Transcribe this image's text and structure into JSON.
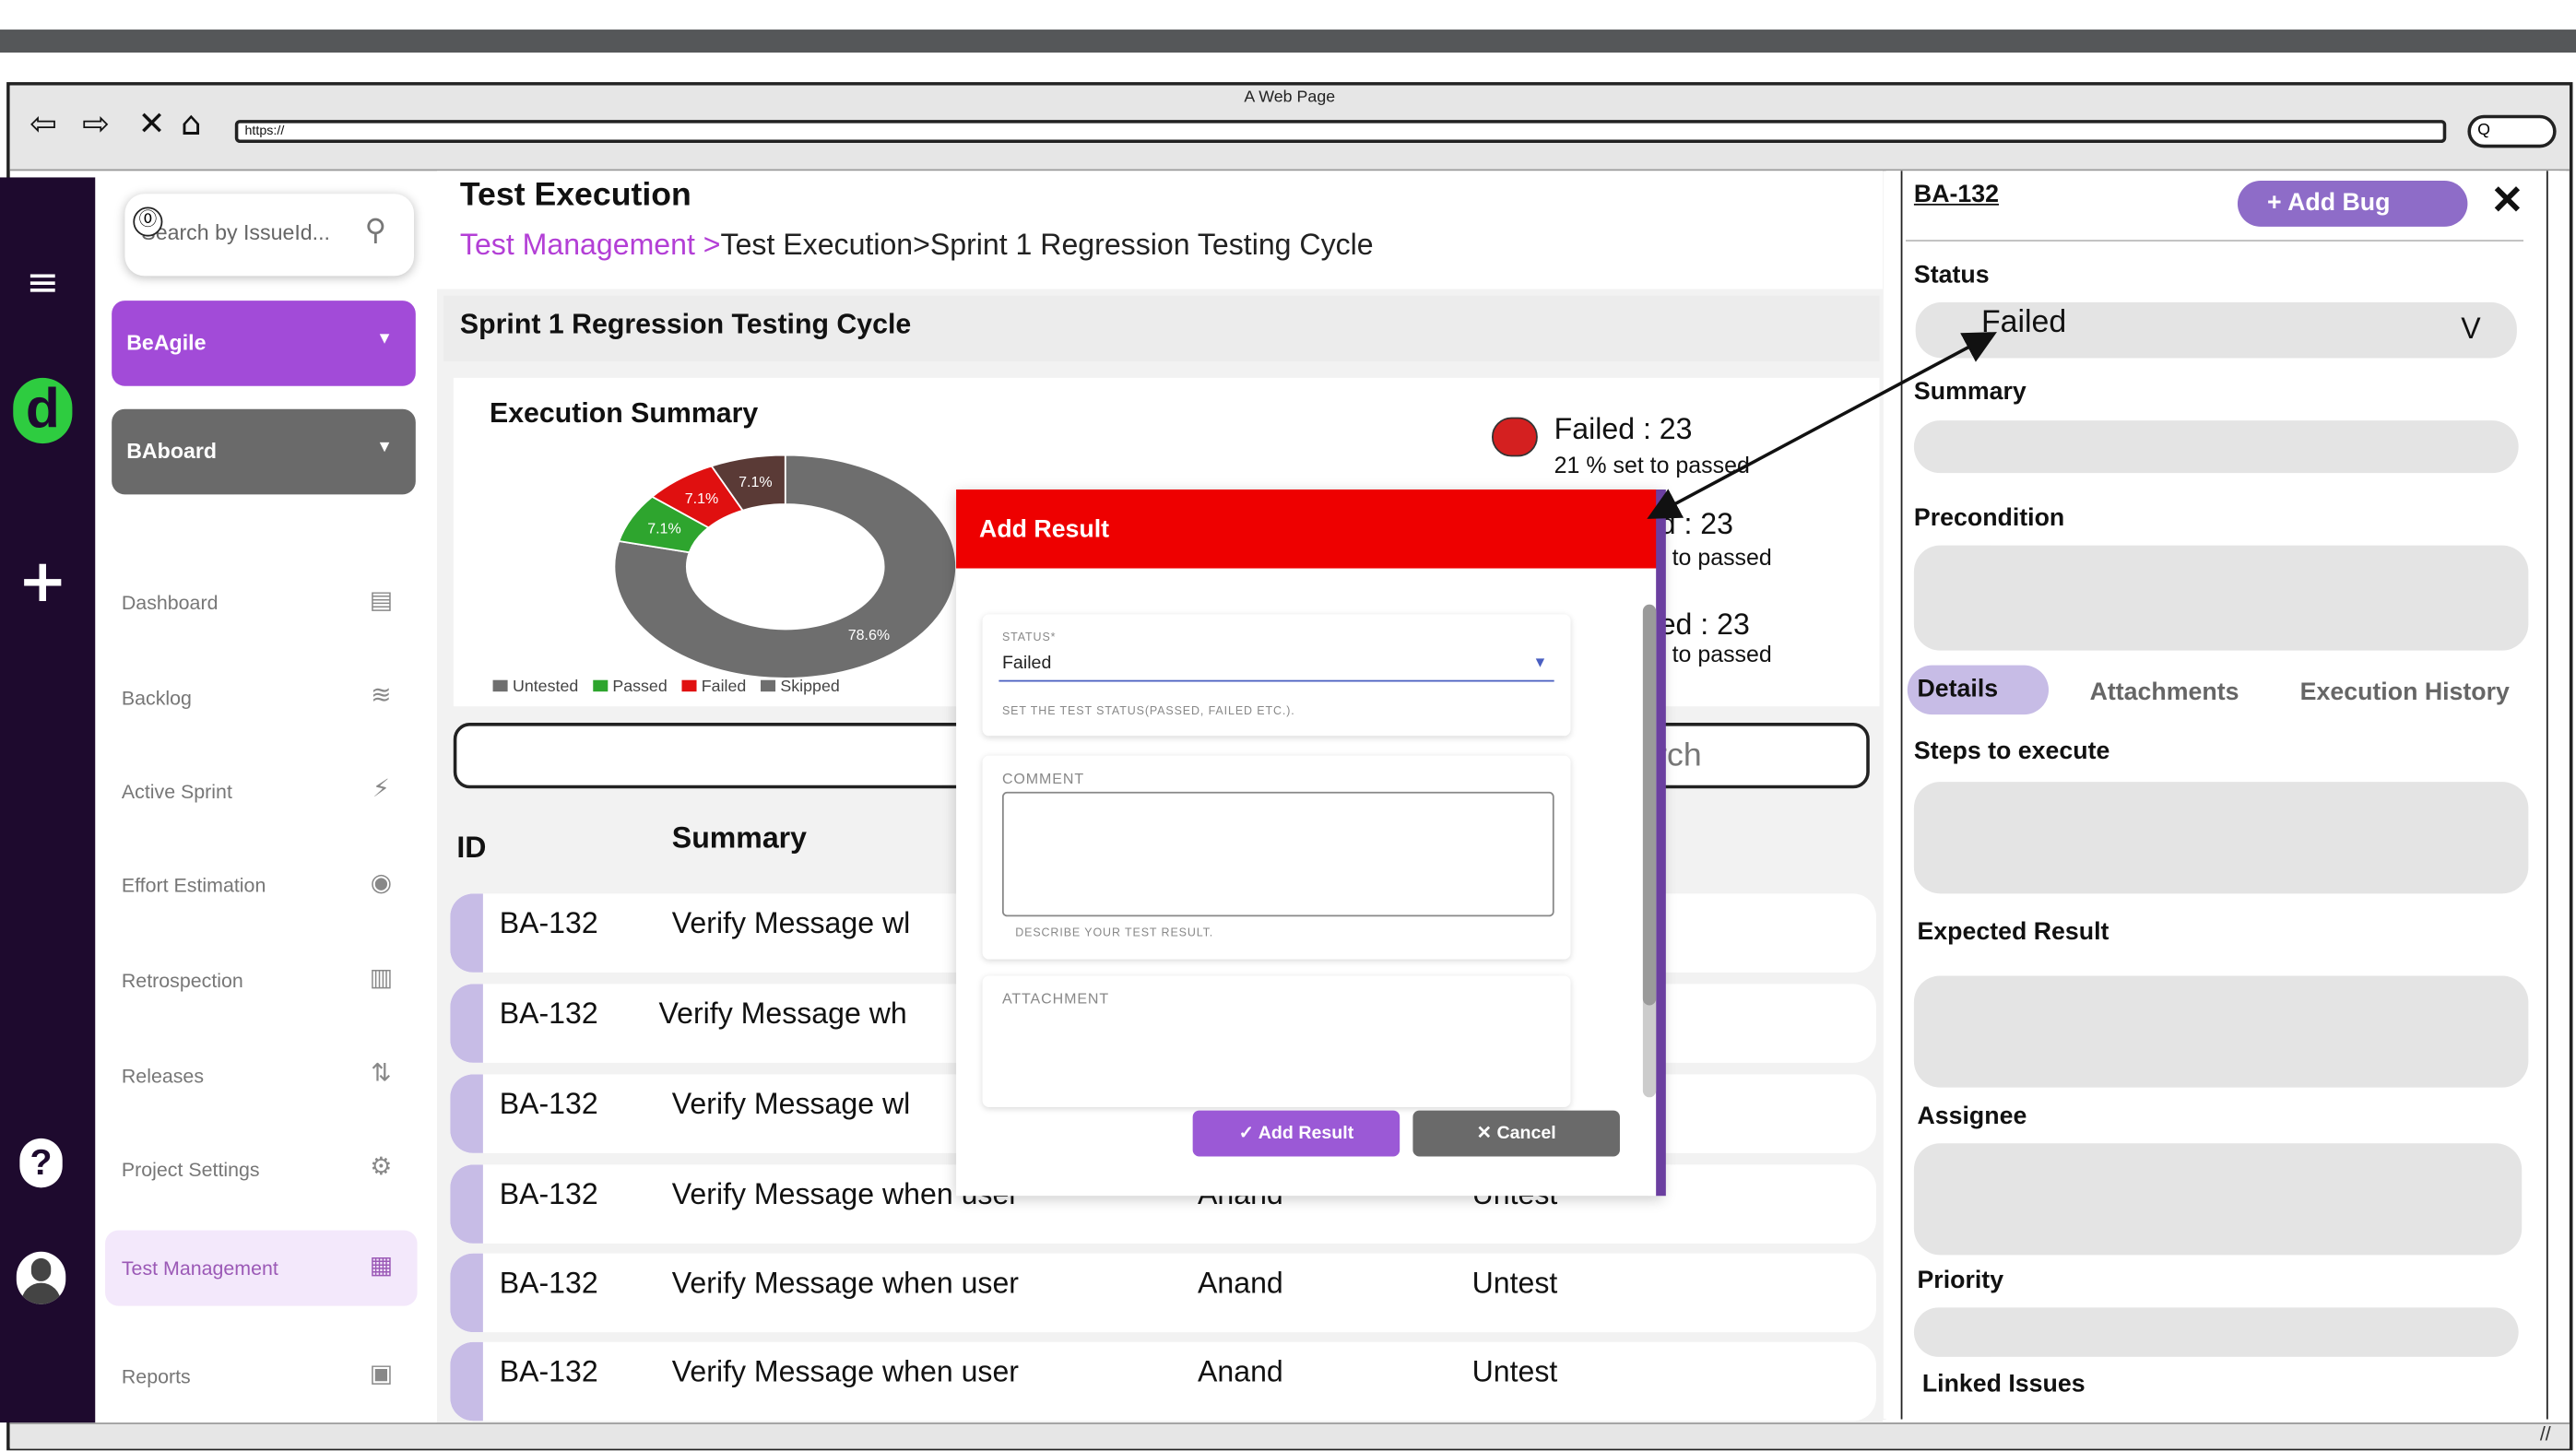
{
  "browser": {
    "page_title": "A Web Page",
    "url": "https://",
    "search_glyph": "Q"
  },
  "side": {
    "search_placeholder": "Search by IssueId...",
    "search_help_glyph": "⓪",
    "org_dropdown": "BeAgile",
    "board_dropdown": "BAboard",
    "nav_items": [
      {
        "label": "Dashboard",
        "icon": "dashboard-icon"
      },
      {
        "label": "Backlog",
        "icon": "backlog-icon"
      },
      {
        "label": "Active Sprint",
        "icon": "sprint-icon"
      },
      {
        "label": "Effort Estimation",
        "icon": "estimation-icon"
      },
      {
        "label": "Retrospection",
        "icon": "retrospection-icon"
      },
      {
        "label": "Releases",
        "icon": "releases-icon"
      },
      {
        "label": "Project Settings",
        "icon": "settings-icon"
      },
      {
        "label": "Test Management",
        "icon": "test-management-icon"
      },
      {
        "label": "Reports",
        "icon": "reports-icon"
      }
    ],
    "active_item": "Test Management"
  },
  "main": {
    "title": "Test Execution",
    "breadcrumb_link": "Test Management >",
    "breadcrumb_rest": "Test Execution>Sprint 1 Regression Testing Cycle",
    "cycle_title": "Sprint 1 Regression Testing Cycle",
    "summary_title": "Execution Summary",
    "search_placeholder": "rch",
    "col_id": "ID",
    "col_summary": "Summary",
    "stats": [
      {
        "big": "Failed : 23",
        "small": "21 % set to passed"
      },
      {
        "big": "d : 23",
        "small": "t to passed"
      },
      {
        "big": "ed : 23",
        "small": "t to passed"
      }
    ],
    "rows": [
      {
        "id": "BA-132",
        "summary": "Verify Message wl",
        "assignee": "",
        "status": ""
      },
      {
        "id": "BA-132",
        "summary": "Verify Message wh",
        "assignee": "",
        "status": ""
      },
      {
        "id": "BA-132",
        "summary": "Verify Message wl",
        "assignee": "",
        "status": ""
      },
      {
        "id": "BA-132",
        "summary": "Verify Message when user",
        "assignee": "Anand",
        "status": "Untest"
      },
      {
        "id": "BA-132",
        "summary": "Verify Message when user",
        "assignee": "Anand",
        "status": "Untest"
      },
      {
        "id": "BA-132",
        "summary": "Verify Message when user",
        "assignee": "Anand",
        "status": "Untest"
      }
    ]
  },
  "chart_data": {
    "type": "pie",
    "title": "Execution Summary",
    "categories": [
      "Untested",
      "Passed",
      "Failed",
      "Skipped"
    ],
    "values": [
      78.6,
      7.1,
      7.1,
      7.1
    ],
    "slice_labels": [
      "78.6%",
      "7.1%",
      "7.1%",
      "7.1%"
    ],
    "colors": [
      "#6e6e6e",
      "#2ea52e",
      "#e01010",
      "#5a3a36"
    ],
    "legend_position": "bottom"
  },
  "modal": {
    "title": "Add Result",
    "status_label": "STATUS*",
    "status_value": "Failed",
    "status_help": "SET THE TEST STATUS(PASSED, FAILED ETC.).",
    "comment_label": "COMMENT",
    "comment_help": "DESCRIBE YOUR TEST RESULT.",
    "attachment_label": "ATTACHMENT",
    "add_button": "Add Result",
    "cancel_button": "Cancel"
  },
  "panel": {
    "bug_id": "BA-132",
    "add_bug": "Add Bug",
    "status_label": "Status",
    "status_value": "Failed",
    "summary_label": "Summary",
    "precondition_label": "Precondition",
    "tabs": [
      "Details",
      "Attachments",
      "Execution History"
    ],
    "steps_label": "Steps to execute",
    "expected_label": "Expected Result",
    "assignee_label": "Assignee",
    "priority_label": "Priority",
    "linked_label": "Linked Issues"
  },
  "colors": {
    "rail": "#1e0a2e",
    "accent_purple": "#9b59d6",
    "brand_green": "#2ecc40",
    "modal_red": "#ee0000"
  }
}
